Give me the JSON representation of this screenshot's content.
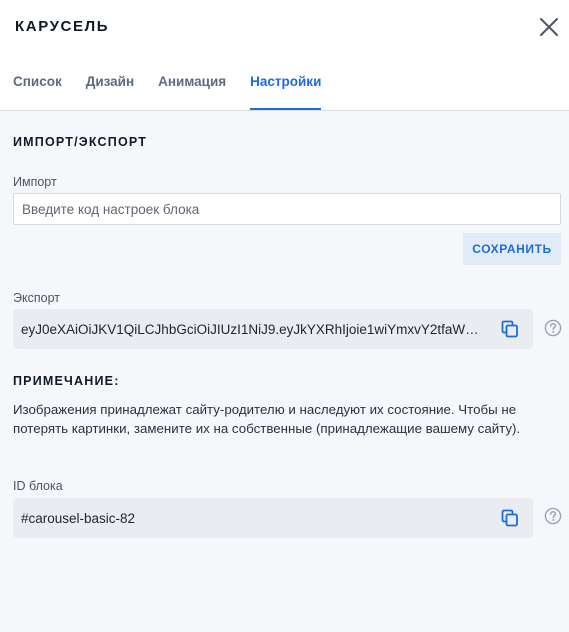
{
  "window": {
    "title": "КАРУСЕЛЬ"
  },
  "tabs": [
    {
      "label": "Список"
    },
    {
      "label": "Дизайн"
    },
    {
      "label": "Анимация"
    },
    {
      "label": "Настройки",
      "active": true
    }
  ],
  "import_export": {
    "heading": "ИМПОРТ/ЭКСПОРТ",
    "import_label": "Импорт",
    "import_value": "",
    "import_placeholder": "Введите код настроек блока",
    "save_label": "СОХРАНИТЬ",
    "export_label": "Экспорт",
    "export_value": "eyJ0eXAiOiJKV1QiLCJhbGciOiJIUzI1NiJ9.eyJkYXRhIjoie1wiYmxvY2tfaWRcIj..."
  },
  "note": {
    "heading": "ПРИМЕЧАНИЕ:",
    "text": "Изображения принадлежат сайту-родителю и наследуют их состояние. Чтобы не потерять картинки, замените их на собственные (принадлежащие вашему сайту)."
  },
  "block_id": {
    "label": "ID блока",
    "value": "#carousel-basic-82"
  },
  "icons": {
    "close": "close-icon",
    "copy": "copy-icon",
    "help": "help-icon"
  },
  "colors": {
    "accent": "#1f6bd8",
    "page_background": "#f5f7fb",
    "code_box_background": "#e9ecf1",
    "save_button_background": "#e2ecf9"
  }
}
